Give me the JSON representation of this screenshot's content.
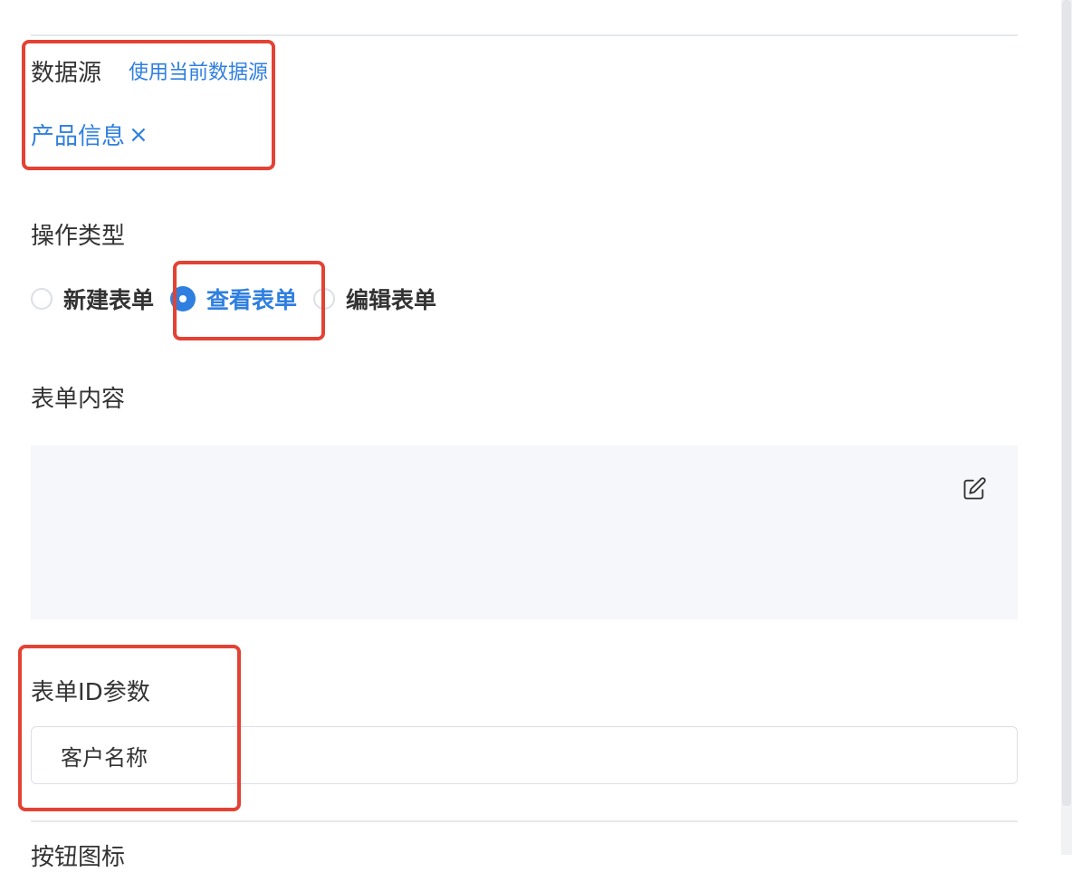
{
  "datasource": {
    "label": "数据源",
    "use_current_link": "使用当前数据源",
    "selected_tag": "产品信息",
    "tag_close_glyph": "×"
  },
  "operation": {
    "label": "操作类型",
    "options": [
      {
        "label": "新建表单",
        "checked": false
      },
      {
        "label": "查看表单",
        "checked": true
      },
      {
        "label": "编辑表单",
        "checked": false
      }
    ]
  },
  "form_content": {
    "label": "表单内容",
    "edit_icon": "edit-icon"
  },
  "form_id_param": {
    "label": "表单ID参数",
    "value": "客户名称"
  },
  "button_icon": {
    "label": "按钮图标"
  },
  "colors": {
    "accent": "#2f7fe0",
    "highlight": "#e34234",
    "content_bg": "#f5f7fa"
  }
}
